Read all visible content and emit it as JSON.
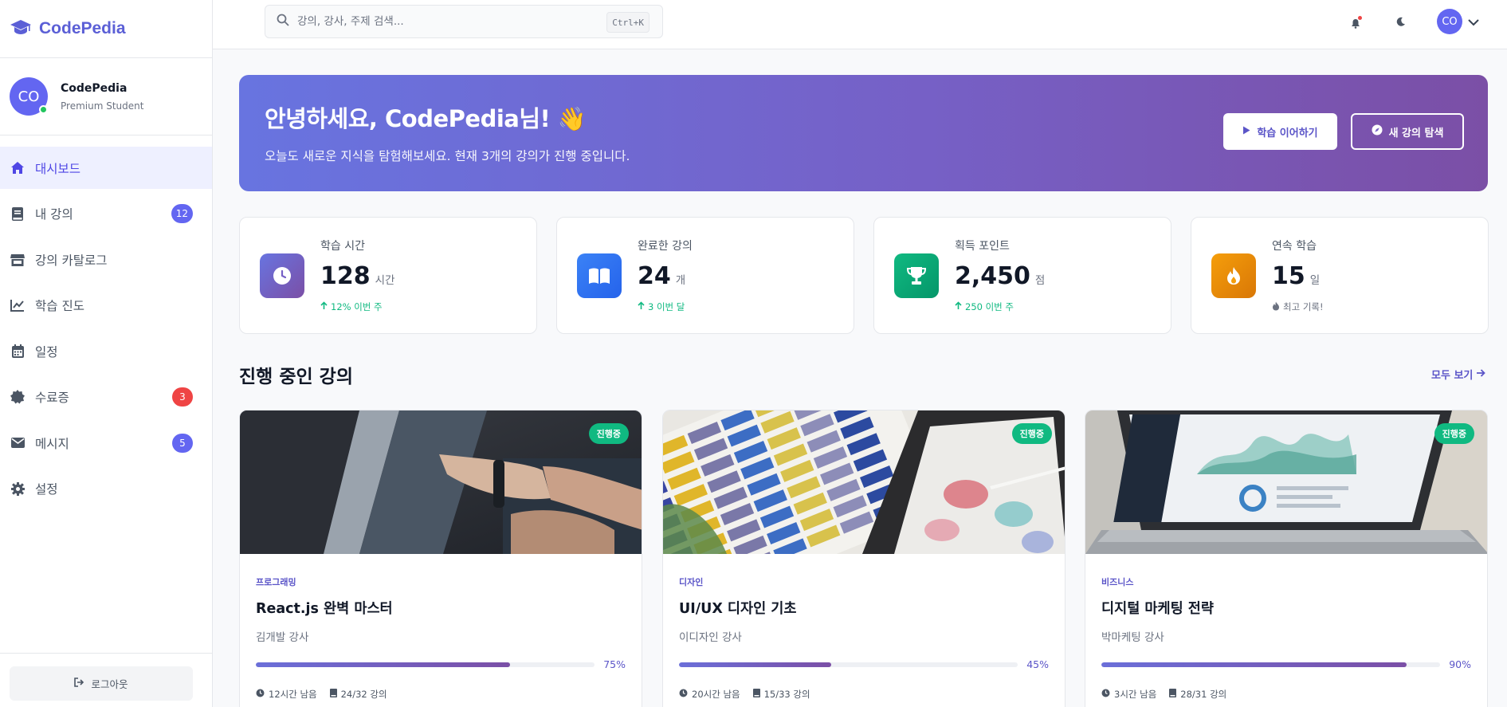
{
  "brand": {
    "name": "CodePedia"
  },
  "profile": {
    "initials": "CO",
    "name": "CodePedia",
    "role": "Premium Student"
  },
  "nav": [
    {
      "label": "대시보드",
      "icon": "home-icon",
      "active": true
    },
    {
      "label": "내 강의",
      "icon": "book-icon",
      "badge": "12",
      "badge_color": "#6366f1"
    },
    {
      "label": "강의 카탈로그",
      "icon": "store-icon"
    },
    {
      "label": "학습 진도",
      "icon": "chart-line-icon"
    },
    {
      "label": "일정",
      "icon": "calendar-icon"
    },
    {
      "label": "수료증",
      "icon": "certificate-icon",
      "badge": "3",
      "badge_color": "#ef4444"
    },
    {
      "label": "메시지",
      "icon": "envelope-icon",
      "badge": "5",
      "badge_color": "#6366f1"
    },
    {
      "label": "설정",
      "icon": "gear-icon"
    }
  ],
  "logout": {
    "label": "로그아웃"
  },
  "topbar": {
    "search_placeholder": "강의, 강사, 주제 검색...",
    "shortcut": "Ctrl+K",
    "user_initials": "CO"
  },
  "hero": {
    "title": "안녕하세요, CodePedia님! 👋",
    "subtitle": "오늘도 새로운 지식을 탐험해보세요. 현재 3개의 강의가 진행 중입니다.",
    "primary_button": "학습 이어하기",
    "secondary_button": "새 강의 탐색"
  },
  "stats": [
    {
      "label": "학습 시간",
      "value": "128",
      "unit": "시간",
      "trend": "12% 이번 주",
      "trend_type": "up",
      "icon": "clock-icon",
      "color": "#7660c6"
    },
    {
      "label": "완료한 강의",
      "value": "24",
      "unit": "개",
      "trend": "3 이번 달",
      "trend_type": "up",
      "icon": "open-book-icon",
      "color": "#3b82f6"
    },
    {
      "label": "획득 포인트",
      "value": "2,450",
      "unit": "점",
      "trend": "250 이번 주",
      "trend_type": "up",
      "icon": "trophy-icon",
      "color": "#10b981"
    },
    {
      "label": "연속 학습",
      "value": "15",
      "unit": "일",
      "trend": "최고 기록!",
      "trend_type": "fire",
      "icon": "fire-icon",
      "color": "#f59e0b"
    }
  ],
  "section": {
    "title": "진행 중인 강의",
    "see_all": "모두 보기"
  },
  "courses": [
    {
      "status": "진행중",
      "category": "프로그래밍",
      "title": "React.js 완벽 마스터",
      "instructor": "김개발 강사",
      "progress": 75,
      "progress_label": "75%",
      "time_left": "12시간 남음",
      "lessons": "24/32 강의",
      "image": "laptop-touch-photo"
    },
    {
      "status": "진행중",
      "category": "디자인",
      "title": "UI/UX 디자인 기초",
      "instructor": "이디자인 강사",
      "progress": 45,
      "progress_label": "45%",
      "time_left": "20시간 남음",
      "lessons": "15/33 강의",
      "image": "color-swatches-photo"
    },
    {
      "status": "진행중",
      "category": "비즈니스",
      "title": "디지털 마케팅 전략",
      "instructor": "박마케팅 강사",
      "progress": 90,
      "progress_label": "90%",
      "time_left": "3시간 남음",
      "lessons": "28/31 강의",
      "image": "analytics-laptop-photo"
    }
  ]
}
